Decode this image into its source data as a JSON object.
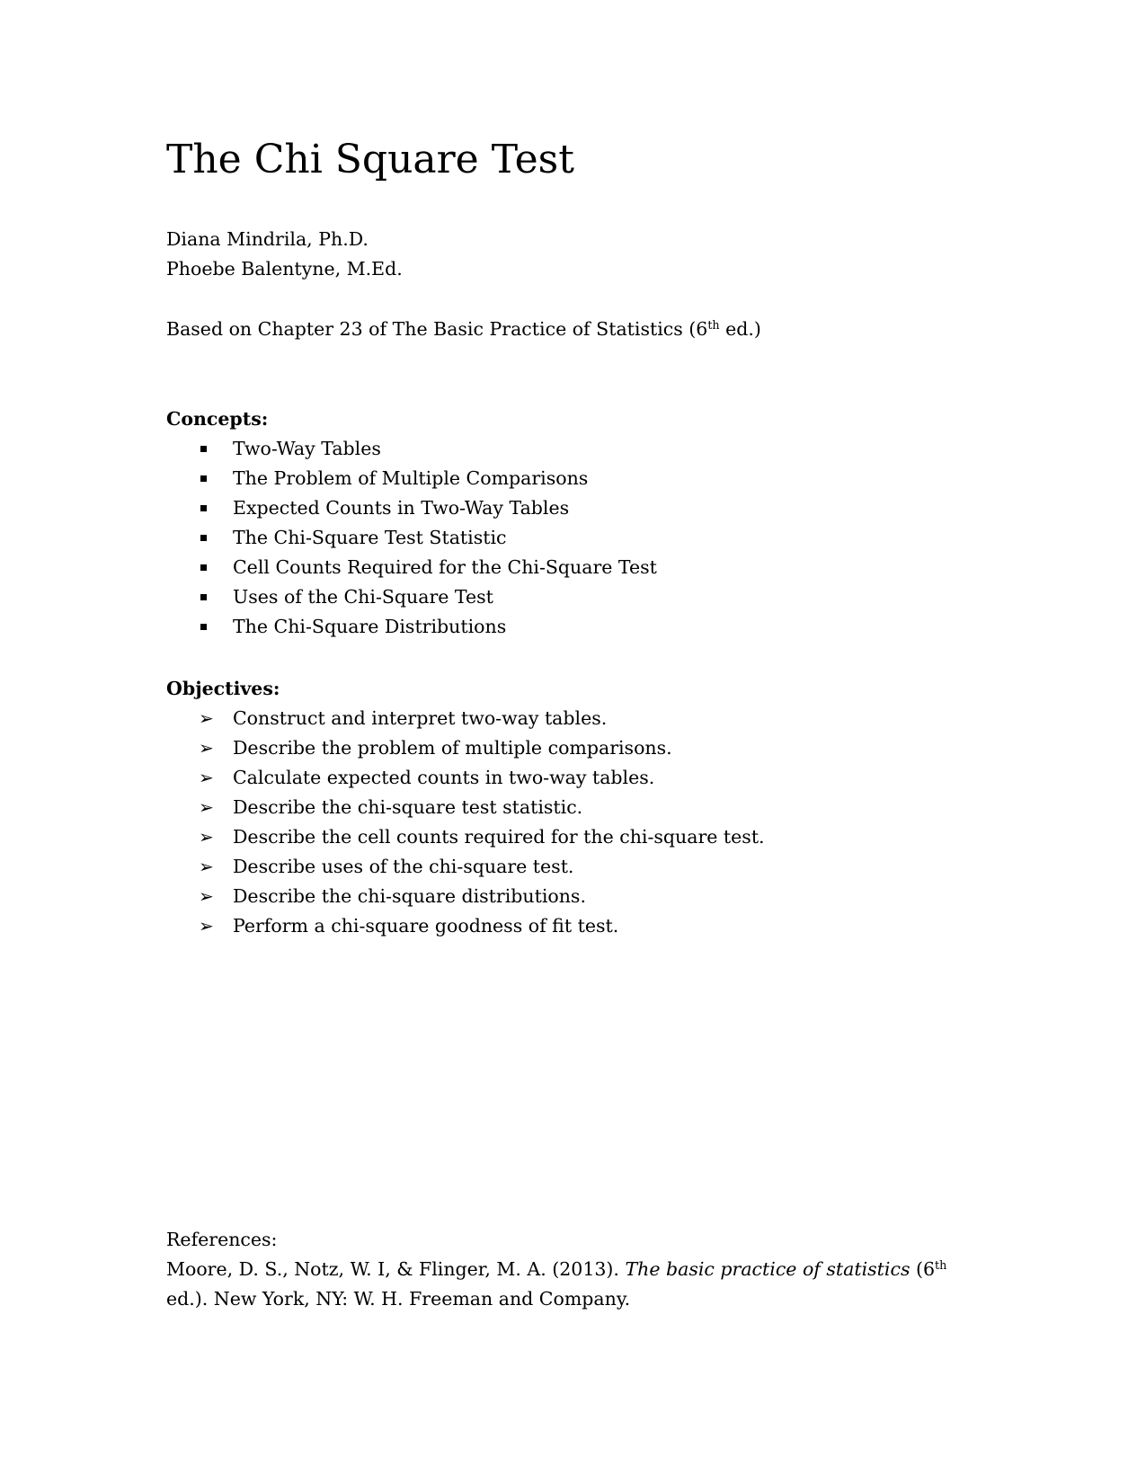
{
  "document": {
    "title": "The Chi Square Test",
    "authors": [
      "Diana Mindrila, Ph.D.",
      "Phoebe Balentyne, M.Ed."
    ],
    "based_on": {
      "prefix": "Based on Chapter 23 of The Basic Practice of Statistics (6",
      "sup": "th",
      "suffix": " ed.)"
    },
    "concepts": {
      "heading": "Concepts:",
      "bullet_icon": "square-bullet-icon",
      "items": [
        "Two-Way Tables",
        "The Problem of Multiple Comparisons",
        "Expected Counts in Two-Way Tables",
        "The Chi-Square Test Statistic",
        "Cell Counts Required for the Chi-Square Test",
        "Uses of the Chi-Square Test",
        "The Chi-Square Distributions"
      ]
    },
    "objectives": {
      "heading": "Objectives:",
      "bullet_icon": "arrowhead-bullet-icon",
      "bullet_glyph": "➢",
      "items": [
        "Construct and interpret two-way tables.",
        "Describe the problem of multiple comparisons.",
        "Calculate expected counts in two-way tables.",
        "Describe the chi-square test statistic.",
        "Describe the cell counts required for the chi-square test.",
        "Describe uses of the chi-square test.",
        "Describe the chi-square distributions.",
        "Perform a chi-square goodness of fit test."
      ]
    },
    "references": {
      "heading": "References:",
      "citation": {
        "authors_year": "Moore, D. S., Notz, W. I, & Flinger, M. A. (2013). ",
        "title_italic": "The basic practice of statistics",
        "edition_prefix": " (6",
        "edition_sup": "th",
        "line2": "ed.). New York, NY: W. H. Freeman and Company."
      }
    }
  }
}
